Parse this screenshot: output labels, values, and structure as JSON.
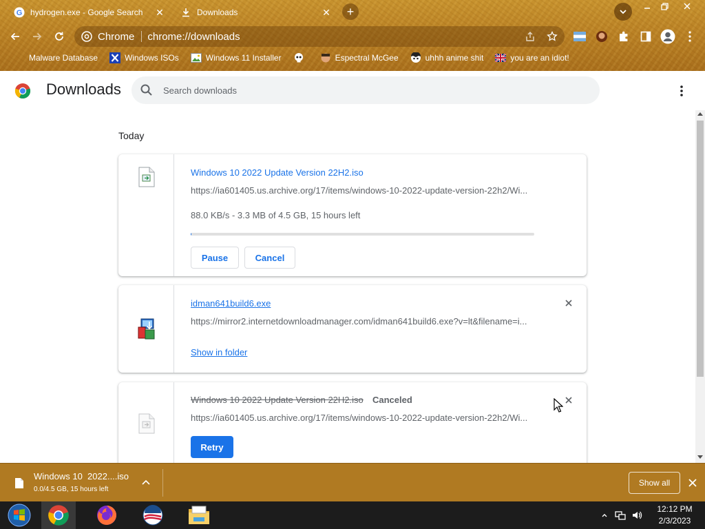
{
  "tabs": [
    {
      "title": "hydrogen.exe - Google Search",
      "icon": "google-icon"
    },
    {
      "title": "Downloads",
      "icon": "download-icon"
    }
  ],
  "omnibox": {
    "site_label": "Chrome",
    "url": "chrome://downloads"
  },
  "bookmarks": [
    {
      "label": "Malware Database",
      "icon": "bookmark-blank-icon"
    },
    {
      "label": "Windows ISOs",
      "icon": "x-logo-icon"
    },
    {
      "label": "Windows 11 Installer",
      "icon": "image-icon"
    },
    {
      "label": "",
      "icon": "skull-icon"
    },
    {
      "label": "Espectral McGee",
      "icon": "face-icon"
    },
    {
      "label": "uhhh anime shit",
      "icon": "anime-icon"
    },
    {
      "label": "you are an idiot!",
      "icon": "flag-icon"
    }
  ],
  "header": {
    "title": "Downloads",
    "search_placeholder": "Search downloads"
  },
  "main": {
    "date_heading": "Today",
    "items": [
      {
        "name": "Windows 10 2022 Update Version 22H2.iso",
        "url": "https://ia601405.us.archive.org/17/items/windows-10-2022-update-version-22h2/Wi...",
        "status": "88.0 KB/s - 3.3 MB of 4.5 GB, 15 hours left",
        "progress": 0.0007,
        "pause_label": "Pause",
        "cancel_label": "Cancel"
      },
      {
        "name": "idman641build6.exe",
        "url": "https://mirror2.internetdownloadmanager.com/idman641build6.exe?v=lt&filename=i...",
        "action_label": "Show in folder"
      },
      {
        "name": "Windows 10 2022 Update Version 22H2.iso",
        "status_tag": "Canceled",
        "url": "https://ia601405.us.archive.org/17/items/windows-10-2022-update-version-22h2/Wi...",
        "retry_label": "Retry"
      }
    ]
  },
  "shelf": {
    "file_name": "Windows 10  2022....iso",
    "file_status": "0.0/4.5 GB, 15 hours left",
    "show_all_label": "Show all"
  },
  "taskbar": {
    "time": "12:12 PM",
    "date": "2/3/2023",
    "apps": [
      "start-orb-icon",
      "chrome-icon",
      "firefox-icon",
      "obama-logo-icon",
      "file-explorer-icon"
    ]
  },
  "colors": {
    "accent": "#1a73e8",
    "theme_gold": "#b87f24",
    "shelf": "#b07a22",
    "taskbar": "#1c1c1c"
  }
}
